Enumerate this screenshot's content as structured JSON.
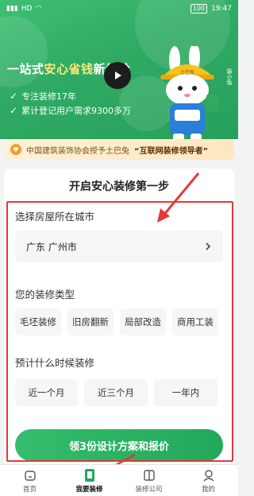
{
  "status_bar": {
    "signal_text": "HD",
    "battery": "100",
    "time": "19:47"
  },
  "hero": {
    "title_prefix": "一站式",
    "title_highlight": "安心省钱",
    "title_suffix": "新体验",
    "bullets": [
      "专注装修17年",
      "累计登记用户需求9300多万"
    ],
    "mascot_label": "土巴兔",
    "mascot_side": "装小兔",
    "accent_color": "#2faa63",
    "highlight_color": "#ffe97a"
  },
  "notice": {
    "prefix": "中国建筑装饰协会授予土巴兔",
    "highlight": "“互联网装修领导者”"
  },
  "card": {
    "title": "开启安心装修第一步",
    "city_section_label": "选择房屋所在城市",
    "city_value": "广东 广州市",
    "type_section_label": "您的装修类型",
    "types": [
      "毛坯装修",
      "旧房翻新",
      "局部改造",
      "商用工装"
    ],
    "time_section_label": "预计什么时候装修",
    "times": [
      "近一个月",
      "近三个月",
      "一年内"
    ],
    "cta_label": "领3份设计方案和报价"
  },
  "tabbar": {
    "items": [
      {
        "label": "首页",
        "icon": "home-icon"
      },
      {
        "label": "我要装修",
        "icon": "renovate-icon",
        "active": true
      },
      {
        "label": "装修公司",
        "icon": "building-icon"
      },
      {
        "label": "我的",
        "icon": "person-icon"
      }
    ]
  }
}
